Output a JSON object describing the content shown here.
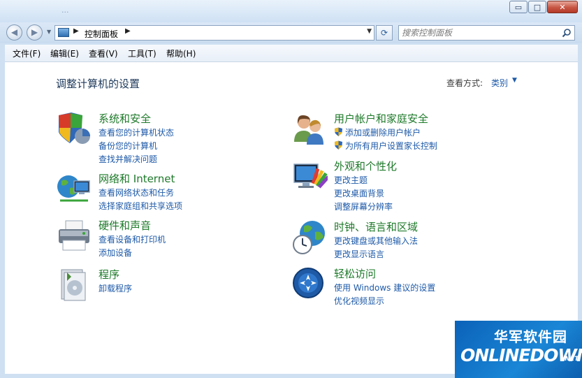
{
  "window": {
    "title": "...",
    "controls": {
      "minimize": "▭",
      "maximize": "□",
      "close": "✕"
    }
  },
  "navbar": {
    "back_glyph": "◀",
    "forward_glyph": "▶",
    "breadcrumb": "控制面板",
    "refresh_glyph": "⟳",
    "search_placeholder": "搜索控制面板"
  },
  "menu": [
    "文件(F)",
    "编辑(E)",
    "查看(V)",
    "工具(T)",
    "帮助(H)"
  ],
  "main": {
    "title": "调整计算机的设置",
    "view_by_label": "查看方式:",
    "view_by_value": "类别"
  },
  "categories": [
    {
      "name": "system-security",
      "title": "系统和安全",
      "icon": "shield-computer-icon",
      "links": [
        "查看您的计算机状态",
        "备份您的计算机",
        "查找并解决问题"
      ]
    },
    {
      "name": "network-internet",
      "title": "网络和 Internet",
      "icon": "network-globe-icon",
      "links": [
        "查看网络状态和任务",
        "选择家庭组和共享选项"
      ]
    },
    {
      "name": "hardware-sound",
      "title": "硬件和声音",
      "icon": "printer-icon",
      "links": [
        "查看设备和打印机",
        "添加设备"
      ]
    },
    {
      "name": "programs",
      "title": "程序",
      "icon": "programs-icon",
      "links": [
        "卸载程序"
      ]
    },
    {
      "name": "user-accounts",
      "title": "用户帐户和家庭安全",
      "icon": "users-icon",
      "links": [
        "添加或删除用户帐户",
        "为所有用户设置家长控制"
      ]
    },
    {
      "name": "appearance",
      "title": "外观和个性化",
      "icon": "monitor-palette-icon",
      "links": [
        "更改主题",
        "更改桌面背景",
        "调整屏幕分辨率"
      ]
    },
    {
      "name": "clock-language",
      "title": "时钟、语言和区域",
      "icon": "clock-globe-icon",
      "links": [
        "更改键盘或其他输入法",
        "更改显示语言"
      ]
    },
    {
      "name": "ease-of-access",
      "title": "轻松访问",
      "icon": "ease-of-access-icon",
      "links": [
        "使用 Windows 建议的设置",
        "优化视频显示"
      ]
    }
  ],
  "watermark": {
    "cn": "华军软件园",
    "en": "ONLINEDOWN",
    "net": ".NET"
  },
  "colors": {
    "link": "#1e5aa8",
    "category_title": "#1e7a2a",
    "heading": "#1e395b"
  }
}
